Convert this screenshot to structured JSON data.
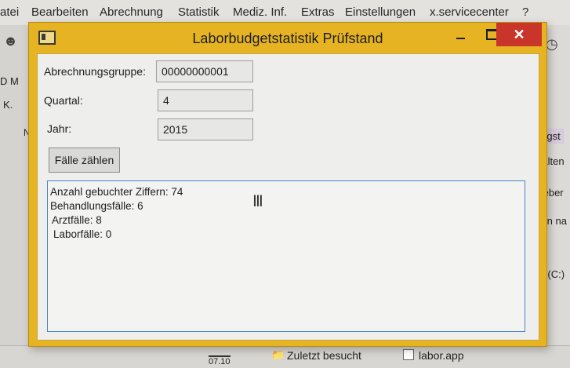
{
  "menubar": {
    "items": [
      "atei",
      "Bearbeiten",
      "Abrechnung",
      "Statistik",
      "Mediz. Inf.",
      "Extras",
      "Einstellungen",
      "x.servicecenter",
      "?"
    ]
  },
  "background": {
    "left_labels": [
      "D M",
      "K.",
      "Na"
    ],
    "right_labels": [
      "lungst",
      "walten",
      "chieber",
      "ieren na",
      "ger (C:)"
    ],
    "bottom": {
      "date": "07.10",
      "recent": "Zuletzt besucht",
      "file": "labor.app"
    }
  },
  "window": {
    "title": "Laborbudgetstatistik Prüfstand",
    "colors": {
      "title_bar": "#e6b422",
      "close_button": "#c9352b",
      "output_border": "#4a86c7"
    }
  },
  "form": {
    "abrechnungsgruppe": {
      "label": "Abrechnungsgruppe:",
      "value": "00000000001"
    },
    "quartal": {
      "label": "Quartal:",
      "value": "4"
    },
    "jahr": {
      "label": "Jahr:",
      "value": "2015"
    },
    "count_button": "Fälle zählen"
  },
  "output": {
    "lines": [
      "Anzahl gebuchter Ziffern: 74",
      "Behandlungsfälle: 6",
      "Arztfälle: 8",
      "Laborfälle: 0"
    ]
  },
  "icons": {
    "window_app": "window-app-icon",
    "minimize": "minimize-icon",
    "maximize": "maximize-icon",
    "close": "close-icon",
    "cursor": "text-cursor-icon"
  }
}
